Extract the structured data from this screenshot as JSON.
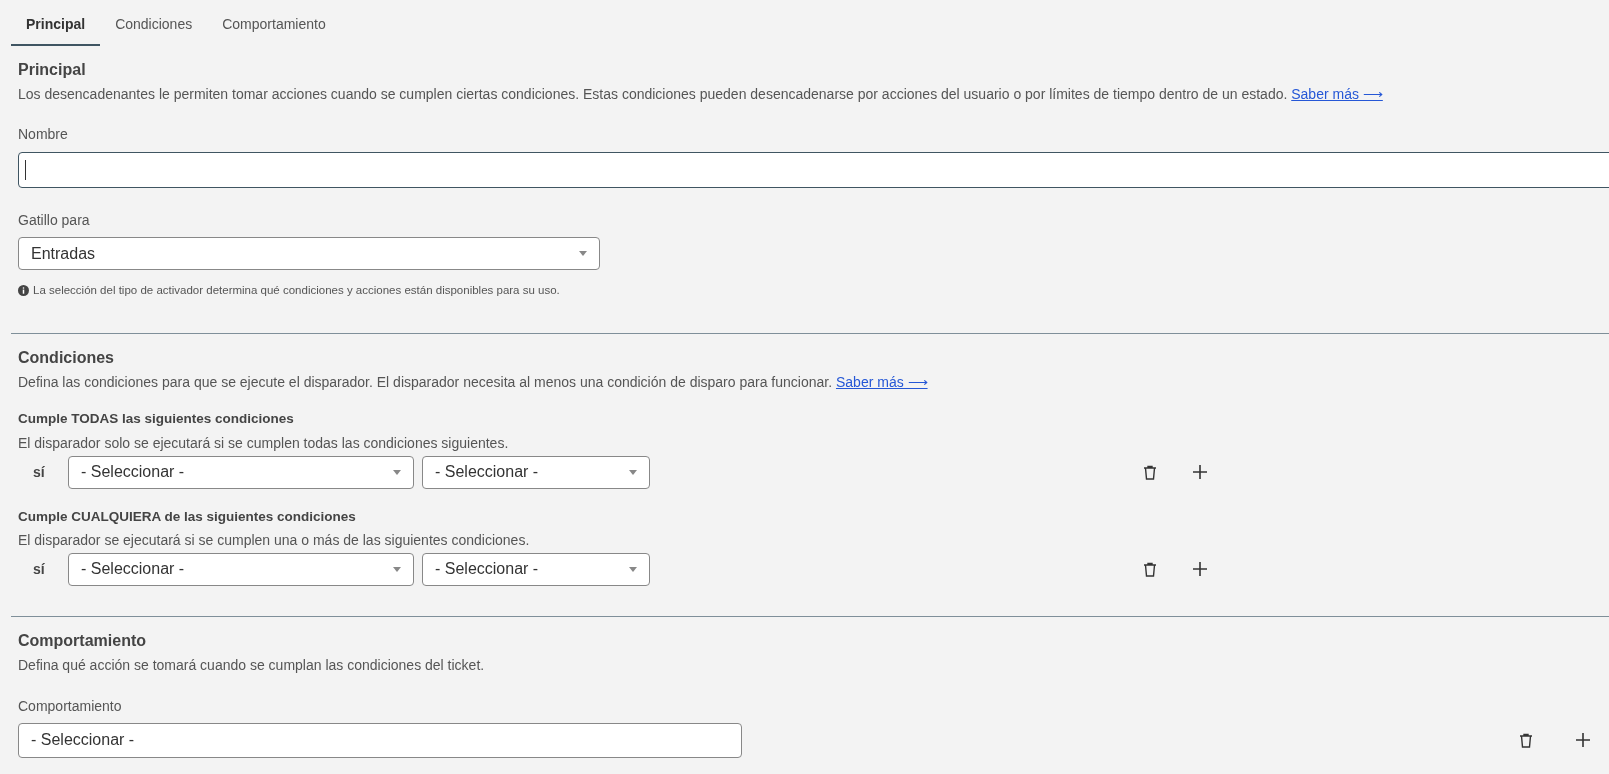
{
  "tabs": [
    {
      "label": "Principal",
      "selected": true
    },
    {
      "label": "Condiciones",
      "selected": false
    },
    {
      "label": "Comportamiento",
      "selected": false
    }
  ],
  "principal": {
    "title": "Principal",
    "description": "Los desencadenantes le permiten tomar acciones cuando se cumplen ciertas condiciones. Estas condiciones pueden desencadenarse por acciones del usuario o por límites de tiempo dentro de un estado.",
    "link": "Saber más ⟶",
    "name_field": {
      "label": "Nombre",
      "focused": true
    },
    "trigger_field": {
      "label": "Gatillo para",
      "value": "Entradas",
      "hint": "La selección del tipo de activador determina qué condiciones y acciones están disponibles para su uso."
    }
  },
  "conditions": {
    "title": "Condiciones",
    "description": "Defina las condiciones para que se ejecute el disparador. El disparador necesita al menos una condición de disparo para funcionar.",
    "link": "Saber más ⟶",
    "groups": [
      {
        "title": "Cumple TODAS las siguientes condiciones",
        "description": "El disparador solo se ejecutará si se cumplen todas las condiciones siguientes.",
        "rows": [
          {
            "prefix": "sí",
            "field": "- Seleccionar -",
            "operator": "- Seleccionar -"
          }
        ]
      },
      {
        "title": "Cumple CUALQUIERA de las siguientes condiciones",
        "description": "El disparador se ejecutará si se cumplen una o más de las siguientes condiciones.",
        "rows": [
          {
            "prefix": "sí",
            "field": "- Seleccionar -",
            "operator": "- Seleccionar -"
          }
        ]
      }
    ]
  },
  "behavior": {
    "title": "Comportamiento",
    "description": "Defina qué acción se tomará cuando se cumplan las condiciones del ticket.",
    "label": "Comportamiento",
    "value": "- Seleccionar -"
  }
}
